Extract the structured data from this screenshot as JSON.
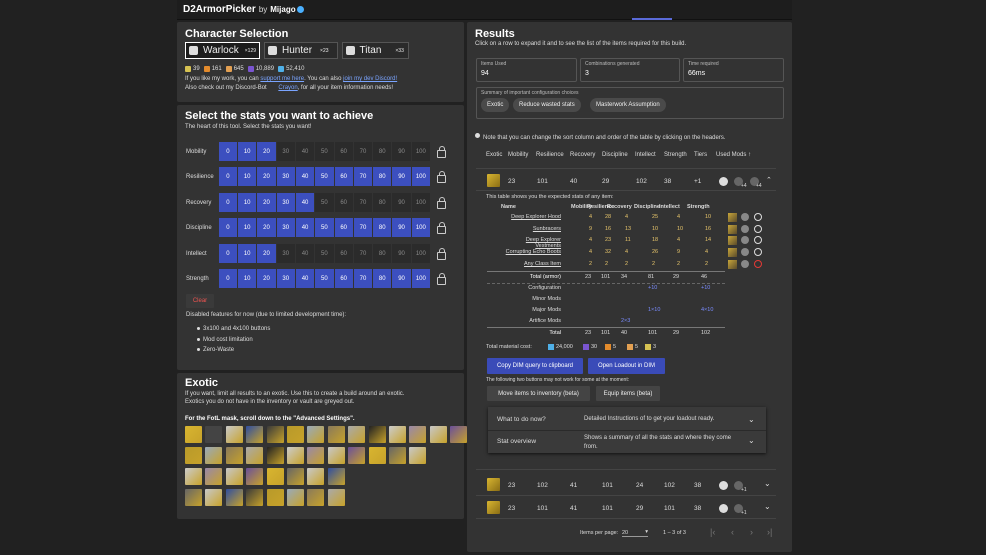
{
  "app": {
    "title": "D2ArmorPicker",
    "by": "by",
    "author": "Mijago"
  },
  "character": {
    "title": "Character Selection",
    "classes": [
      {
        "name": "Warlock",
        "count": "×129"
      },
      {
        "name": "Hunter",
        "count": "×23"
      },
      {
        "name": "Titan",
        "count": "×33"
      }
    ],
    "currencies": [
      "39",
      "161",
      "645",
      "10,889",
      "52,410"
    ],
    "line1a": "If you like my work, you can ",
    "line1b": "support me here",
    "line1c": ". You can also ",
    "line1d": "join my dev Discord!",
    "line2a": "Also check out my Discord-Bot ",
    "line2b": "Crayon",
    "line2c": ", for all your item information needs!"
  },
  "stats": {
    "title": "Select the stats you want to achieve",
    "subtitle": "The heart of this tool. Select the stats you want!",
    "values": [
      "0",
      "10",
      "20",
      "30",
      "40",
      "50",
      "60",
      "70",
      "80",
      "90",
      "100"
    ],
    "rows": [
      {
        "name": "Mobility",
        "level": 2
      },
      {
        "name": "Resilience",
        "level": 10
      },
      {
        "name": "Recovery",
        "level": 4
      },
      {
        "name": "Discipline",
        "level": 10
      },
      {
        "name": "Intellect",
        "level": 2
      },
      {
        "name": "Strength",
        "level": 10
      }
    ],
    "clear": "Clear",
    "disabled_title": "Disabled features for now (due to limited development time):",
    "disabled": [
      "3x100 and 4x100 buttons",
      "Mod cost limitation",
      "Zero-Waste"
    ]
  },
  "exotic": {
    "title": "Exotic",
    "desc1": "If you want, limit all results to an exotic. Use this to create a build around an exotic.",
    "desc2": "Exotics you do not have in the inventory or vault are greyed out.",
    "note": "For the FotL mask, scroll down to the \"Advanced Settings\"."
  },
  "results": {
    "title": "Results",
    "subtitle": "Click on a row to expand it and to see the list of the items required for this build.",
    "fields": [
      {
        "label": "Items Used",
        "value": "94"
      },
      {
        "label": "Combinations generated",
        "value": "3"
      },
      {
        "label": "Time required",
        "value": "66ms"
      }
    ],
    "summary_label": "Summary of important configuration choices",
    "chips": [
      "Exotic",
      "Reduce wasted stats",
      "Masterwork Assumption"
    ],
    "note": "Note that you can change the sort column and order of the table by clicking on the headers.",
    "headers": [
      "Exotic",
      "Mobility",
      "Resilience",
      "Recovery",
      "Discipline",
      "Intellect",
      "Strength",
      "Tiers",
      "Used Mods ↑"
    ],
    "row1": [
      "23",
      "101",
      "40",
      "29",
      "102",
      "38",
      "+1",
      "+4"
    ],
    "expected": "This table shows you the expected stats of any item:",
    "item_headers": [
      "Name",
      "Mobility",
      "Resilience",
      "Recovery",
      "Discipline",
      "Intellect",
      "Strength"
    ],
    "items": [
      {
        "name": "Deep Explorer Hood",
        "v": [
          "4",
          "28",
          "4",
          "25",
          "4",
          "10"
        ]
      },
      {
        "name": "Sunbracers",
        "v": [
          "9",
          "16",
          "13",
          "10",
          "10",
          "16"
        ]
      },
      {
        "name": "Deep Explorer Vestments",
        "v": [
          "4",
          "23",
          "11",
          "18",
          "4",
          "14"
        ]
      },
      {
        "name": "Corrupting Echo Boots",
        "v": [
          "4",
          "32",
          "4",
          "26",
          "9",
          "4"
        ]
      },
      {
        "name": "Any Class Item",
        "v": [
          "2",
          "2",
          "2",
          "2",
          "2",
          "2"
        ]
      }
    ],
    "total_armor": {
      "label": "Total (armor)",
      "v": [
        "23",
        "101",
        "34",
        "81",
        "29",
        "46"
      ]
    },
    "configuration": {
      "label": "Configuration",
      "v": [
        "",
        "",
        "",
        "+10",
        "",
        "+10"
      ]
    },
    "minor": {
      "label": "Minor Mods"
    },
    "major": {
      "label": "Major Mods",
      "v": [
        "",
        "",
        "",
        "1×10",
        "",
        "4×10"
      ]
    },
    "artifice": {
      "label": "Artifice Mods",
      "v": [
        "",
        "",
        "2×3",
        "",
        "",
        ""
      ]
    },
    "total": {
      "label": "Total",
      "v": [
        "23",
        "101",
        "40",
        "101",
        "29",
        "102"
      ]
    },
    "material_label": "Total material cost:",
    "materials": [
      "24,000",
      "30",
      "5",
      "5",
      "3"
    ],
    "copy_btn": "Copy DIM query to clipboard",
    "open_btn": "Open Loadout in DIM",
    "warn": "The following two buttons may not work for some at the moment:",
    "move_btn": "Move items to inventory (beta)",
    "equip_btn": "Equip items (beta)",
    "whatnow": "What to do now?",
    "whatnow_desc": "Detailed Instructions of to get your loadout ready.",
    "overview": "Stat overview",
    "overview_desc": "Shows a summary of all the stats and where they come from.",
    "row2": [
      "23",
      "102",
      "41",
      "101",
      "24",
      "102",
      "38",
      "+1"
    ],
    "row3": [
      "23",
      "101",
      "41",
      "101",
      "29",
      "101",
      "38",
      "+1"
    ],
    "per_page_label": "Items per page:",
    "per_page": "20",
    "range": "1 – 3 of 3"
  }
}
